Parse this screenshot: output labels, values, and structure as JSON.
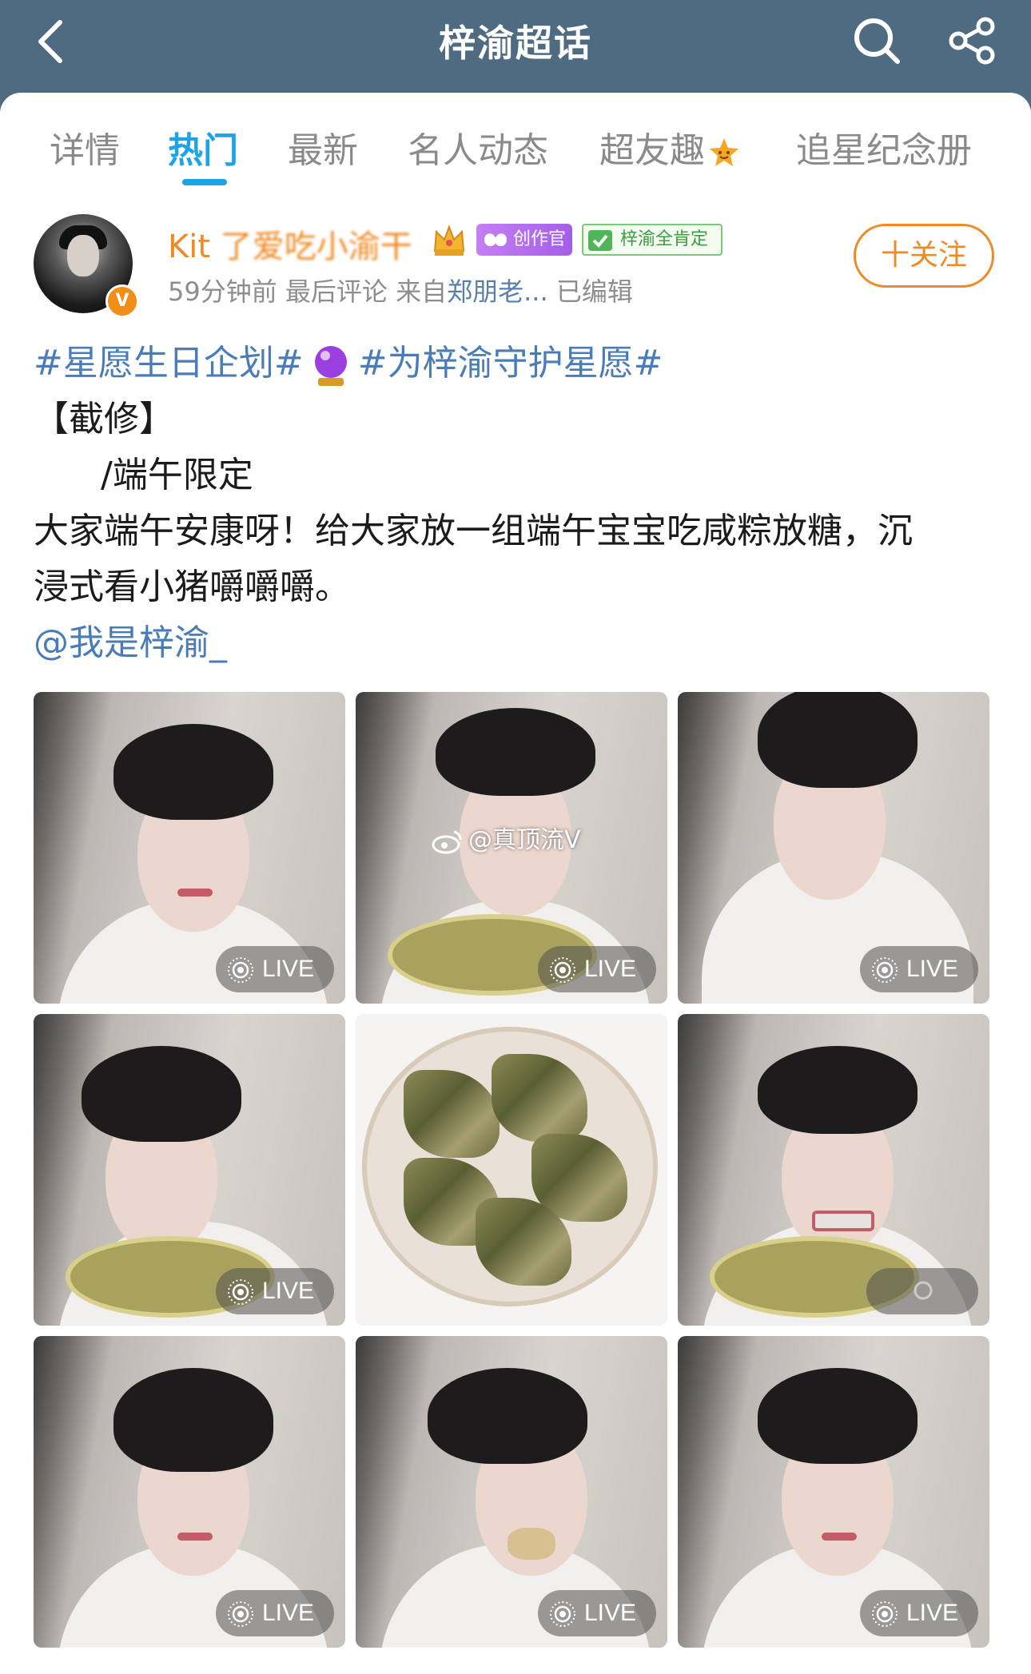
{
  "header": {
    "title": "梓渝超话",
    "back_icon": "chevron-left-icon",
    "search_icon": "search-icon",
    "share_icon": "share-icon",
    "background": "#4f6b81"
  },
  "tabs": [
    {
      "label": "详情",
      "active": false
    },
    {
      "label": "热门",
      "active": true
    },
    {
      "label": "最新",
      "active": false
    },
    {
      "label": "名人动态",
      "active": false
    },
    {
      "label": "超友趣",
      "active": false,
      "badge_icon": "star-face-icon"
    },
    {
      "label": "追星纪念册",
      "active": false
    }
  ],
  "post": {
    "author": {
      "name_visible": "Kit",
      "name_obscured": "了爱吃小渝干",
      "verified": true,
      "creator_badge": "创作官",
      "fan_badge": "梓渝全肯定"
    },
    "meta": {
      "time": "59分钟前",
      "last_comment": "最后评论",
      "source_prefix": "来自",
      "source": "郑朋老...",
      "edited": "已编辑"
    },
    "follow_label": "十关注",
    "text": {
      "topic1": "#星愿生日企划#",
      "topic2": "#为梓渝守护星愿#",
      "line2": "【截修】",
      "line3": "/端午限定",
      "line4": "大家端午安康呀！给大家放一组端午宝宝吃咸粽放糖，沉",
      "line5": "浸式看小猪嚼嚼嚼。",
      "mention": "@我是梓渝_"
    },
    "images": [
      {
        "live_label": "LIVE"
      },
      {
        "live_label": "LIVE"
      },
      {
        "live_label": "LIVE"
      },
      {
        "live_label": "LIVE"
      },
      {
        "live_label": ""
      },
      {
        "live_label": ""
      },
      {
        "live_label": "LIVE"
      },
      {
        "live_label": "LIVE"
      },
      {
        "live_label": "LIVE"
      }
    ],
    "watermark": "@真顶流V"
  },
  "colors": {
    "accent_blue": "#1ba5e6",
    "orange": "#f08a24",
    "link_blue": "#4a7db8"
  }
}
